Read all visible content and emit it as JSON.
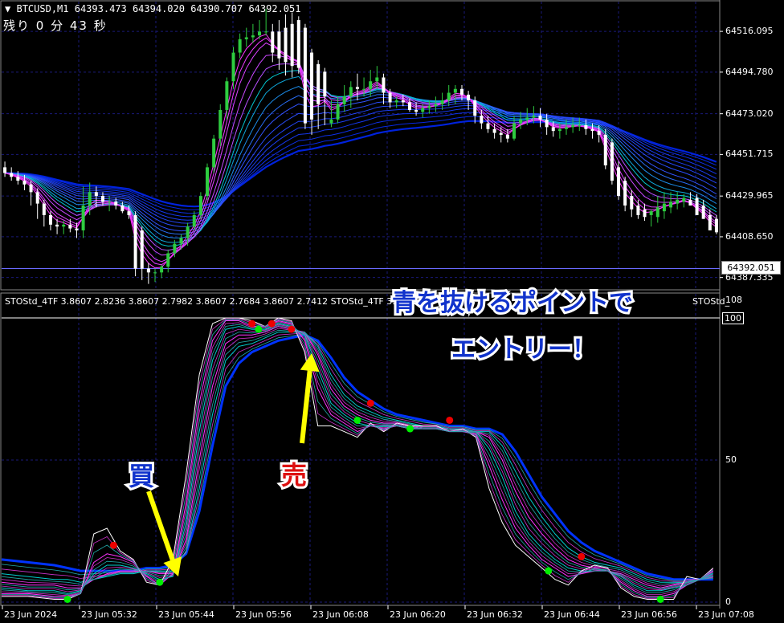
{
  "header": {
    "symbol_line": "BTCUSD,M1  64393.473 64394.020 64390.707 64392.051",
    "countdown": "残り 0 分 43 秒"
  },
  "price_axis": {
    "ticks": [
      "64516.095",
      "64494.780",
      "64473.020",
      "64451.715",
      "64429.965",
      "64408.650",
      "64387.335"
    ],
    "current_price": "64392.051"
  },
  "indicator": {
    "label_line": "STOStd_4TF 3.8607 2.8236 3.8607 2.7982 3.8607 2.7684 3.8607 2.7412  STOStd_4TF 3.8607 2.7",
    "label_right": "STOStd_",
    "axis_ticks": [
      "108",
      "100",
      "50",
      "0"
    ]
  },
  "time_axis": [
    "23 Jun 2024",
    "23 Jun 05:32",
    "23 Jun 05:44",
    "23 Jun 05:56",
    "23 Jun 06:08",
    "23 Jun 06:20",
    "23 Jun 06:32",
    "23 Jun 06:44",
    "23 Jun 06:56",
    "23 Jun 07:08"
  ],
  "annotations": {
    "headline_1": "青を抜けるポイントで",
    "headline_2": "エントリー！",
    "buy_label": "買",
    "sell_label": "売"
  },
  "colors": {
    "background": "#000000",
    "grid": "#1a1a7a",
    "bull_candle": "#2ecc40",
    "bear_candle": "#ffffff",
    "ribbon_slow": "#0022dd",
    "ribbon_fast": "#ff33ff",
    "ribbon_mid": "#00cccc",
    "arrow_highlight": "#ffff00",
    "buy_dot": "#00ee00",
    "sell_dot": "#ee0000"
  },
  "chart_data": [
    {
      "type": "candlestick",
      "symbol": "BTCUSD",
      "timeframe": "M1",
      "ylim": [
        64383,
        64530
      ],
      "x": [
        "05:20",
        "05:21",
        "05:22",
        "05:23",
        "05:24",
        "05:25",
        "05:26",
        "05:27",
        "05:28",
        "05:29",
        "05:30",
        "05:31",
        "05:32",
        "05:33",
        "05:34",
        "05:35",
        "05:36",
        "05:37",
        "05:38",
        "05:39",
        "05:40",
        "05:41",
        "05:42",
        "05:43",
        "05:44",
        "05:45",
        "05:46",
        "05:47",
        "05:48",
        "05:49",
        "05:50",
        "05:51",
        "05:52",
        "05:53",
        "05:54",
        "05:55",
        "05:56",
        "05:57",
        "05:58",
        "05:59",
        "06:00",
        "06:01",
        "06:02",
        "06:03",
        "06:04",
        "06:05",
        "06:06",
        "06:07",
        "06:08",
        "06:09",
        "06:10",
        "06:11",
        "06:12",
        "06:13",
        "06:14",
        "06:15",
        "06:16",
        "06:17",
        "06:18",
        "06:19",
        "06:20",
        "06:21",
        "06:22",
        "06:23",
        "06:24",
        "06:25",
        "06:26",
        "06:27",
        "06:28",
        "06:29",
        "06:30",
        "06:31",
        "06:32",
        "06:33",
        "06:34",
        "06:35",
        "06:36",
        "06:37",
        "06:38",
        "06:39",
        "06:40",
        "06:41",
        "06:42",
        "06:43",
        "06:44",
        "06:45",
        "06:46",
        "06:47",
        "06:48",
        "06:49",
        "06:50",
        "06:51",
        "06:52",
        "06:53",
        "06:54",
        "06:55",
        "06:56",
        "06:57",
        "06:58",
        "06:59",
        "07:00",
        "07:01",
        "07:02",
        "07:03",
        "07:04",
        "07:05",
        "07:06",
        "07:07",
        "07:08",
        "07:09"
      ],
      "open": [
        64445,
        64442,
        64440,
        64438,
        64436,
        64432,
        64426,
        64420,
        64415,
        64414,
        64415,
        64413,
        64412,
        64425,
        64432,
        64430,
        64427,
        64427,
        64425,
        64422,
        64420,
        64412,
        64392,
        64390,
        64390,
        64393,
        64400,
        64405,
        64408,
        64414,
        64420,
        64430,
        64445,
        64460,
        64475,
        64490,
        64505,
        64512,
        64513,
        64514,
        64516,
        64516,
        64516,
        64518,
        64520,
        64522,
        64518,
        64505,
        64499,
        64495,
        64468,
        64470,
        64478,
        64482,
        64487,
        64486,
        64486,
        64490,
        64492,
        64484,
        64479,
        64480,
        64479,
        64475,
        64474,
        64476,
        64477,
        64478,
        64480,
        64484,
        64486,
        64483,
        64480,
        64472,
        64468,
        64465,
        64463,
        64462,
        64460,
        64468,
        64470,
        64471,
        64472,
        64470,
        64466,
        64464,
        64465,
        64466,
        64467,
        64467,
        64465,
        64464,
        64462,
        64458,
        64445,
        64438,
        64430,
        64425,
        64423,
        64420,
        64419,
        64422,
        64424,
        64426,
        64427,
        64428,
        64429,
        64425,
        64420,
        64418
      ],
      "high": [
        64448,
        64445,
        64443,
        64441,
        64438,
        64434,
        64428,
        64422,
        64418,
        64417,
        64418,
        64416,
        64435,
        64437,
        64435,
        64432,
        64430,
        64429,
        64427,
        64425,
        64422,
        64414,
        64395,
        64392,
        64394,
        64402,
        64407,
        64410,
        64416,
        64422,
        64432,
        64447,
        64462,
        64478,
        64492,
        64508,
        64515,
        64518,
        64520,
        64522,
        64528,
        64520,
        64522,
        64525,
        64526,
        64524,
        64520,
        64507,
        64501,
        64497,
        64480,
        64482,
        64488,
        64490,
        64494,
        64492,
        64496,
        64498,
        64494,
        64486,
        64482,
        64483,
        64481,
        64479,
        64478,
        64480,
        64482,
        64484,
        64488,
        64488,
        64488,
        64485,
        64482,
        64475,
        64472,
        64468,
        64466,
        64465,
        64472,
        64474,
        64476,
        64477,
        64476,
        64473,
        64469,
        64468,
        64470,
        64471,
        64471,
        64470,
        64468,
        64467,
        64465,
        64460,
        64448,
        64440,
        64433,
        64428,
        64426,
        64423,
        64430,
        64432,
        64432,
        64432,
        64431,
        64432,
        64431,
        64428,
        64423,
        64420
      ],
      "low": [
        64440,
        64438,
        64436,
        64433,
        64425,
        64418,
        64414,
        64412,
        64410,
        64410,
        64411,
        64408,
        64408,
        64420,
        64424,
        64425,
        64422,
        64423,
        64421,
        64418,
        64388,
        64386,
        64384,
        64385,
        64387,
        64390,
        64398,
        64402,
        64404,
        64412,
        64418,
        64428,
        64442,
        64456,
        64470,
        64486,
        64502,
        64508,
        64510,
        64512,
        64514,
        64500,
        64496,
        64493,
        64492,
        64494,
        64465,
        64462,
        64465,
        64467,
        64466,
        64468,
        64474,
        64476,
        64480,
        64482,
        64482,
        64486,
        64478,
        64476,
        64476,
        64477,
        64474,
        64472,
        64471,
        64473,
        64474,
        64475,
        64477,
        64478,
        64480,
        64475,
        64468,
        64465,
        64463,
        64460,
        64458,
        64458,
        64459,
        64465,
        64467,
        64468,
        64466,
        64462,
        64461,
        64460,
        64462,
        64463,
        64464,
        64462,
        64460,
        64458,
        64444,
        64436,
        64428,
        64422,
        64419,
        64418,
        64417,
        64414,
        64416,
        64418,
        64421,
        64423,
        64424,
        64425,
        64422,
        64418,
        64412,
        64410
      ],
      "close": [
        64442,
        64440,
        64438,
        64436,
        64432,
        64426,
        64420,
        64415,
        64414,
        64415,
        64413,
        64412,
        64425,
        64432,
        64430,
        64427,
        64427,
        64425,
        64422,
        64420,
        64392,
        64392,
        64390,
        64390,
        64393,
        64400,
        64405,
        64408,
        64414,
        64420,
        64430,
        64445,
        64460,
        64475,
        64490,
        64505,
        64512,
        64513,
        64514,
        64516,
        64516,
        64505,
        64502,
        64500,
        64498,
        64497,
        64468,
        64470,
        64478,
        64482,
        64470,
        64478,
        64482,
        64487,
        64486,
        64486,
        64490,
        64492,
        64484,
        64479,
        64480,
        64479,
        64475,
        64474,
        64476,
        64477,
        64478,
        64480,
        64484,
        64486,
        64483,
        64480,
        64472,
        64468,
        64465,
        64463,
        64462,
        64460,
        64468,
        64470,
        64471,
        64472,
        64470,
        64466,
        64464,
        64465,
        64466,
        64467,
        64467,
        64465,
        64464,
        64462,
        64446,
        64438,
        64430,
        64425,
        64423,
        64420,
        64419,
        64422,
        64424,
        64426,
        64427,
        64428,
        64429,
        64425,
        64420,
        64418,
        64412,
        64411
      ],
      "current_price": 64392.051
    },
    {
      "type": "line",
      "name": "STOStd_4TF",
      "ylim": [
        0,
        100
      ],
      "yticks": [
        0,
        50,
        100
      ],
      "x": [
        "05:20",
        "05:24",
        "05:28",
        "05:30",
        "05:32",
        "05:34",
        "05:36",
        "05:38",
        "05:40",
        "05:42",
        "05:44",
        "05:46",
        "05:48",
        "05:50",
        "05:52",
        "05:54",
        "05:56",
        "05:58",
        "06:00",
        "06:02",
        "06:04",
        "06:06",
        "06:08",
        "06:10",
        "06:12",
        "06:14",
        "06:16",
        "06:18",
        "06:20",
        "06:22",
        "06:24",
        "06:26",
        "06:28",
        "06:30",
        "06:32",
        "06:34",
        "06:36",
        "06:38",
        "06:40",
        "06:42",
        "06:44",
        "06:46",
        "06:48",
        "06:50",
        "06:52",
        "06:54",
        "06:56",
        "06:58",
        "07:00",
        "07:02",
        "07:04",
        "07:06",
        "07:08"
      ],
      "series": [
        {
          "values": [
            2,
            2,
            1,
            1,
            3,
            24,
            26,
            18,
            15,
            7,
            6,
            15,
            45,
            80,
            98,
            100,
            100,
            99,
            97,
            100,
            99,
            88,
            62,
            62,
            60,
            58,
            63,
            60,
            63,
            62,
            62,
            62,
            60,
            61,
            58,
            40,
            28,
            20,
            16,
            12,
            8,
            6,
            11,
            13,
            12,
            5,
            2,
            1,
            1,
            1,
            9,
            8,
            12
          ]
        },
        {
          "values": [
            3,
            3,
            2,
            2,
            3,
            14,
            17,
            16,
            14,
            9,
            6,
            10,
            35,
            70,
            92,
            99,
            99,
            97,
            97,
            99,
            98,
            92,
            75,
            66,
            63,
            60,
            62,
            61,
            62,
            61,
            61,
            61,
            60,
            60,
            59,
            48,
            36,
            26,
            20,
            15,
            12,
            9,
            10,
            11,
            11,
            7,
            4,
            2,
            2,
            3,
            6,
            8,
            11
          ]
        },
        {
          "values": [
            5,
            4,
            4,
            3,
            4,
            10,
            13,
            13,
            12,
            10,
            8,
            9,
            28,
            60,
            85,
            96,
            97,
            96,
            96,
            98,
            97,
            94,
            82,
            70,
            66,
            63,
            62,
            62,
            62,
            61,
            61,
            61,
            60,
            60,
            60,
            54,
            44,
            32,
            24,
            19,
            15,
            12,
            11,
            11,
            11,
            9,
            6,
            4,
            4,
            5,
            6,
            8,
            10
          ]
        },
        {
          "values": [
            7,
            6,
            6,
            5,
            5,
            8,
            10,
            11,
            11,
            11,
            10,
            10,
            22,
            50,
            76,
            91,
            94,
            94,
            95,
            97,
            96,
            95,
            87,
            75,
            69,
            66,
            64,
            63,
            63,
            62,
            61,
            61,
            61,
            60,
            60,
            58,
            50,
            39,
            30,
            24,
            19,
            15,
            13,
            12,
            11,
            10,
            8,
            6,
            5,
            6,
            7,
            8,
            9
          ]
        },
        {
          "values": [
            10,
            9,
            8,
            8,
            7,
            8,
            9,
            10,
            10,
            11,
            11,
            11,
            18,
            40,
            66,
            85,
            90,
            91,
            93,
            95,
            95,
            95,
            90,
            80,
            73,
            69,
            67,
            65,
            64,
            63,
            62,
            62,
            61,
            61,
            60,
            60,
            55,
            46,
            37,
            30,
            24,
            19,
            16,
            14,
            13,
            12,
            10,
            8,
            7,
            7,
            7,
            8,
            9
          ]
        },
        {
          "values": [
            15,
            14,
            13,
            12,
            11,
            11,
            11,
            11,
            11,
            12,
            12,
            13,
            17,
            32,
            55,
            76,
            84,
            88,
            90,
            92,
            93,
            94,
            92,
            86,
            79,
            74,
            71,
            68,
            66,
            65,
            64,
            63,
            62,
            62,
            61,
            61,
            59,
            53,
            45,
            37,
            31,
            25,
            21,
            18,
            16,
            14,
            12,
            10,
            9,
            8,
            8,
            8,
            8
          ]
        }
      ],
      "sell_signals": [
        [
          "05:37",
          20
        ],
        [
          "05:58",
          98
        ],
        [
          "06:01",
          98
        ],
        [
          "06:04",
          96
        ],
        [
          "06:16",
          70
        ],
        [
          "06:28",
          64
        ],
        [
          "06:48",
          16
        ]
      ],
      "buy_signals": [
        [
          "05:30",
          1
        ],
        [
          "05:44",
          7
        ],
        [
          "05:59",
          96
        ],
        [
          "06:14",
          64
        ],
        [
          "06:22",
          61
        ],
        [
          "06:43",
          11
        ],
        [
          "07:00",
          1
        ]
      ]
    }
  ]
}
